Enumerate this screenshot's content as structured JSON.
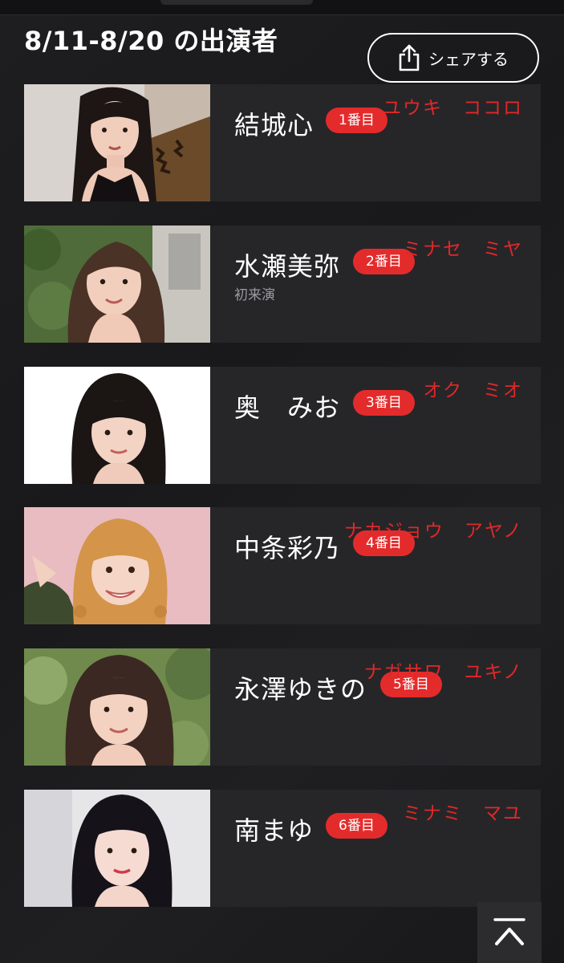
{
  "header": {
    "title": "8/11-8/20 の出演者",
    "share_label": "シェアする"
  },
  "performers": [
    {
      "name": "結城心",
      "order": "1番目",
      "kana": "ユウキ　ココロ",
      "note": ""
    },
    {
      "name": "水瀬美弥",
      "order": "2番目",
      "kana": "ミナセ　ミヤ",
      "note": "初来演"
    },
    {
      "name": "奥　みお",
      "order": "3番目",
      "kana": "オク　ミオ",
      "note": ""
    },
    {
      "name": "中条彩乃",
      "order": "4番目",
      "kana": "ナカジョウ　アヤノ",
      "note": ""
    },
    {
      "name": "永澤ゆきの",
      "order": "5番目",
      "kana": "ナガサワ　ユキノ",
      "note": ""
    },
    {
      "name": "南まゆ",
      "order": "6番目",
      "kana": "ミナミ　マユ",
      "note": ""
    }
  ],
  "colors": {
    "badge": "#e42b2b",
    "kana_annotation": "#e02828",
    "card_background": "#262629"
  },
  "icons": {
    "share": "share-icon",
    "scroll_top": "chevron-up-icon"
  }
}
